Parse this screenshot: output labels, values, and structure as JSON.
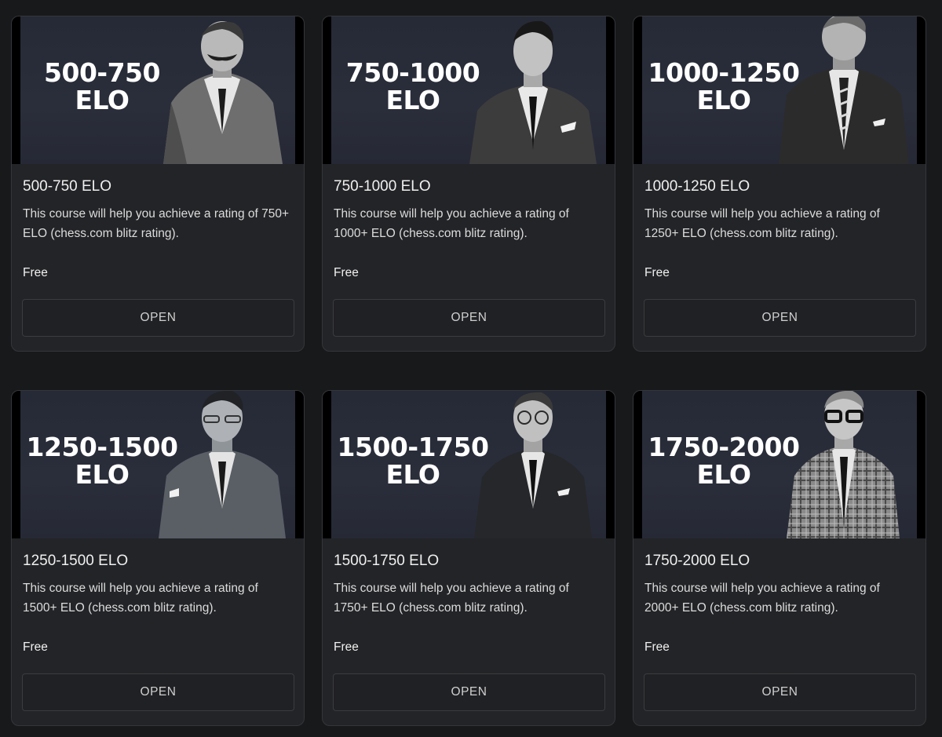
{
  "courses": [
    {
      "banner_range": "500-750",
      "banner_unit": "ELO",
      "title": "500-750 ELO",
      "description": "This course will help you achieve a rating of 750+ ELO (chess.com blitz rating).",
      "price": "Free",
      "button": "OPEN",
      "portrait": "portrait-mustache-man"
    },
    {
      "banner_range": "750-1000",
      "banner_unit": "ELO",
      "title": "750-1000 ELO",
      "description": "This course will help you achieve a rating of 1000+ ELO (chess.com blitz rating).",
      "price": "Free",
      "button": "OPEN",
      "portrait": "portrait-slick-hair-man"
    },
    {
      "banner_range": "1000-1250",
      "banner_unit": "ELO",
      "title": "1000-1250 ELO",
      "description": "This course will help you achieve a rating of 1250+ ELO (chess.com blitz rating).",
      "price": "Free",
      "button": "OPEN",
      "portrait": "portrait-striped-tie-man"
    },
    {
      "banner_range": "1250-1500",
      "banner_unit": "ELO",
      "title": "1250-1500 ELO",
      "description": "This course will help you achieve a rating of 1500+ ELO (chess.com blitz rating).",
      "price": "Free",
      "button": "OPEN",
      "portrait": "portrait-glasses-suit-man"
    },
    {
      "banner_range": "1500-1750",
      "banner_unit": "ELO",
      "title": "1500-1750 ELO",
      "description": "This course will help you achieve a rating of 1750+ ELO (chess.com blitz rating).",
      "price": "Free",
      "button": "OPEN",
      "portrait": "portrait-round-glasses-man"
    },
    {
      "banner_range": "1750-2000",
      "banner_unit": "ELO",
      "title": "1750-2000 ELO",
      "description": "This course will help you achieve a rating of 2000+ ELO (chess.com blitz rating).",
      "price": "Free",
      "button": "OPEN",
      "portrait": "portrait-plaid-jacket-man"
    }
  ],
  "colors": {
    "page_background": "#18191b",
    "card_background": "#232427",
    "banner_background": "#282c38",
    "text_primary": "#f0f0f0",
    "text_secondary": "#dcdcdc"
  }
}
